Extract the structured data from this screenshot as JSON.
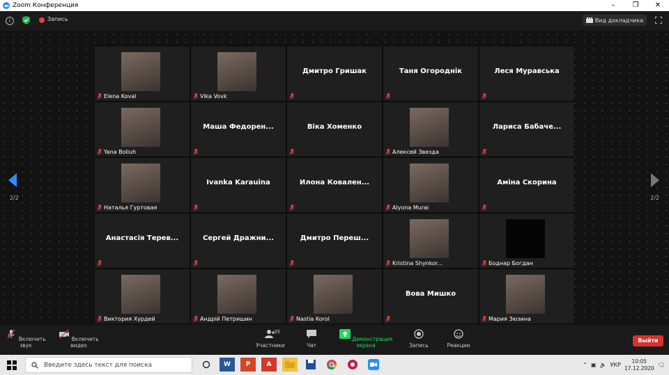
{
  "window": {
    "title": "Zoom Конференция"
  },
  "topbar": {
    "recording_label": "Запись",
    "speaker_view_label": "Вид докладчика"
  },
  "gallery": {
    "page_left": "2/2",
    "page_right": "2/2",
    "tiles": [
      {
        "name": "Elena Koval",
        "has_photo": true,
        "big_name": ""
      },
      {
        "name": "Vika Vovk",
        "has_photo": true,
        "big_name": ""
      },
      {
        "name": "",
        "has_photo": false,
        "big_name": "Дмитро Гришак"
      },
      {
        "name": "",
        "has_photo": false,
        "big_name": "Таня Огороднік"
      },
      {
        "name": "",
        "has_photo": false,
        "big_name": "Леся Муравська"
      },
      {
        "name": "Yana Boliuh",
        "has_photo": true,
        "big_name": ""
      },
      {
        "name": "",
        "has_photo": false,
        "big_name": "Маша Федорен..."
      },
      {
        "name": "",
        "has_photo": false,
        "big_name": "Віка Хоменко"
      },
      {
        "name": "Алексей Звезда",
        "has_photo": true,
        "big_name": ""
      },
      {
        "name": "",
        "has_photo": false,
        "big_name": "Лариса Бабаче..."
      },
      {
        "name": "Наталья Гуртовая",
        "has_photo": true,
        "big_name": ""
      },
      {
        "name": "",
        "has_photo": false,
        "big_name": "Ivanka Karauina"
      },
      {
        "name": "",
        "has_photo": false,
        "big_name": "Илона Ковален..."
      },
      {
        "name": "Alyona Murai",
        "has_photo": true,
        "big_name": ""
      },
      {
        "name": "",
        "has_photo": false,
        "big_name": "Аміна Скорина"
      },
      {
        "name": "",
        "has_photo": false,
        "big_name": "Анастасія Терев..."
      },
      {
        "name": "",
        "has_photo": false,
        "big_name": "Сергей Дражни..."
      },
      {
        "name": "",
        "has_photo": false,
        "big_name": "Дмитро Переш..."
      },
      {
        "name": "Kristina Shynkor...",
        "has_photo": true,
        "big_name": ""
      },
      {
        "name": "Боднар Богдан",
        "has_photo": true,
        "dark": true,
        "big_name": ""
      },
      {
        "name": "Виктория Хурдей",
        "has_photo": true,
        "big_name": ""
      },
      {
        "name": "Андрій Петришин",
        "has_photo": true,
        "big_name": ""
      },
      {
        "name": "Nastia Korol",
        "has_photo": true,
        "big_name": ""
      },
      {
        "name": "",
        "has_photo": false,
        "big_name": "Вова Мишко"
      },
      {
        "name": "Мария Зюзина",
        "has_photo": true,
        "big_name": ""
      }
    ]
  },
  "toolbar": {
    "unmute": "Включить звук",
    "start_video": "Включить видео",
    "participants": "Участники",
    "participants_count": "35",
    "chat": "Чат",
    "share_screen": "Демонстрация экрана",
    "record": "Запись",
    "reactions": "Реакции",
    "leave": "Выйти"
  },
  "taskbar": {
    "search_placeholder": "Введите здесь текст для поиска",
    "language": "УКР",
    "time": "10:05",
    "date": "17.12.2020"
  },
  "colors": {
    "zoom_blue": "#2d8cff",
    "leave_red": "#d8302d",
    "share_green": "#23d959"
  }
}
